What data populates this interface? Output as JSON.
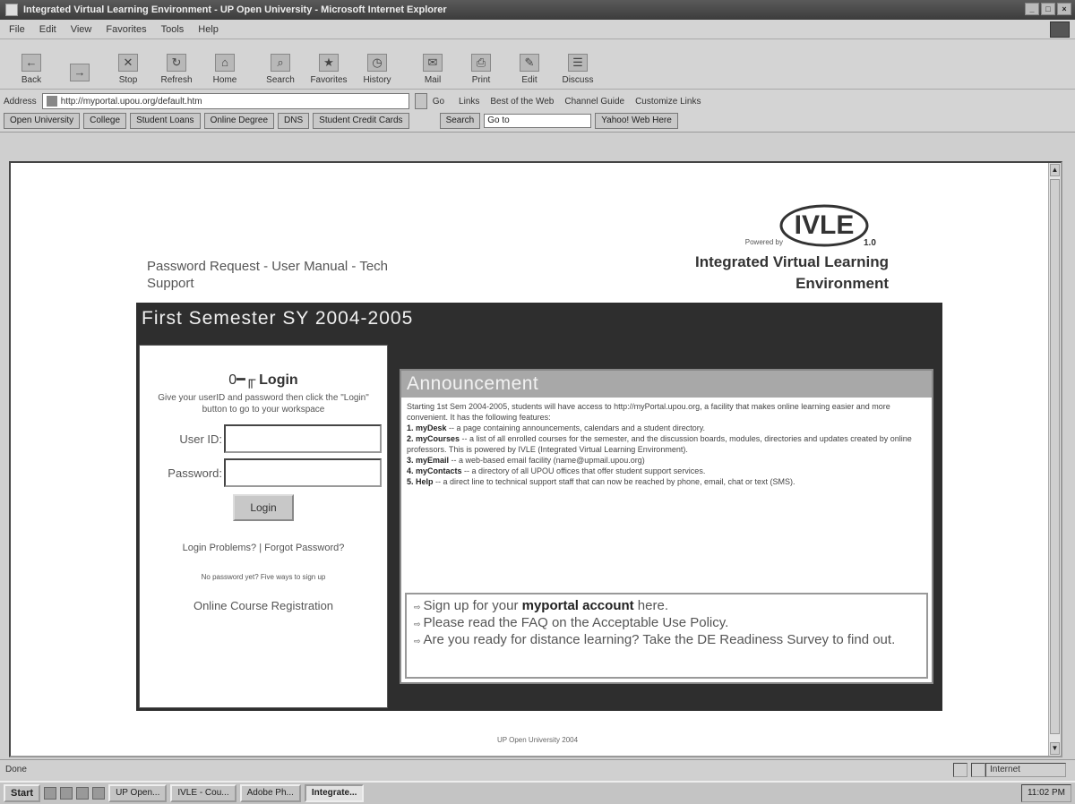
{
  "window": {
    "title": "Integrated Virtual Learning Environment - UP Open University - Microsoft Internet Explorer"
  },
  "menu": [
    "File",
    "Edit",
    "View",
    "Favorites",
    "Tools",
    "Help"
  ],
  "toolbar": [
    {
      "label": "Back",
      "icon": "back-arrow-icon"
    },
    {
      "label": "",
      "icon": "forward-arrow-icon"
    },
    {
      "label": "Stop",
      "icon": "stop-icon"
    },
    {
      "label": "Refresh",
      "icon": "refresh-icon"
    },
    {
      "label": "Home",
      "icon": "home-icon"
    },
    {
      "label": "Search",
      "icon": "search-icon"
    },
    {
      "label": "Favorites",
      "icon": "favorites-icon"
    },
    {
      "label": "History",
      "icon": "history-icon"
    },
    {
      "label": "Mail",
      "icon": "mail-icon"
    },
    {
      "label": "Print",
      "icon": "print-icon"
    },
    {
      "label": "Edit",
      "icon": "edit-icon"
    },
    {
      "label": "Discuss",
      "icon": "discuss-icon"
    }
  ],
  "address": {
    "label": "Address",
    "url": "http://myportal.upou.org/default.htm",
    "go": "Go",
    "links_label": "Links",
    "links": [
      "Best of the Web",
      "Channel Guide",
      "Customize Links"
    ]
  },
  "favbar": {
    "buttons": [
      "Open University",
      "College",
      "Student Loans",
      "Online Degree",
      "DNS",
      "Student Credit Cards"
    ],
    "search_label": "Search",
    "search_value": "Go to",
    "yahoo": "Yahoo! Web Here"
  },
  "page": {
    "top_links_1": "Password Request - User Manual - Tech",
    "top_links_2": "Support",
    "logo_text": "IVLE",
    "logo_version": "1.0",
    "powered_by": "Powered by",
    "brand_1": "Integrated Virtual Learning",
    "brand_2": "Environment",
    "semester": "First Semester SY 2004-2005"
  },
  "login": {
    "heading": "Login",
    "description": "Give your userID and password then click the \"Login\" button to go to your workspace",
    "userid_label": "User ID:",
    "password_label": "Password:",
    "button": "Login",
    "problems_link": "Login Problems? | Forgot Password?",
    "no_password": "No password yet? Five ways to sign up",
    "registration": "Online Course Registration"
  },
  "announcement": {
    "title": "Announcement",
    "intro": "Starting 1st Sem 2004-2005, students will have access to http://myPortal.upou.org, a facility that makes online learning easier and more convenient. It has the following features:",
    "items": [
      {
        "key": "1. myDesk",
        "text": " -- a page containing announcements, calendars and a student directory."
      },
      {
        "key": "2. myCourses",
        "text": " -- a list of all enrolled courses for the semester, and the discussion boards, modules, directories and updates created by online professors. This is powered by IVLE (Integrated Virtual Learning Environment)."
      },
      {
        "key": "3. myEmail",
        "text": " -- a web-based email facility (name@upmail.upou.org)"
      },
      {
        "key": "4. myContacts",
        "text": " -- a directory of all UPOU offices that offer student support services."
      },
      {
        "key": "5. Help",
        "text": " -- a direct line to technical support staff that can now be reached by phone, email, chat or text (SMS)."
      }
    ],
    "links": [
      {
        "pre": "Sign up for your ",
        "bold": "myportal account",
        "post": " here."
      },
      {
        "pre": "Please read the FAQ on the Acceptable Use Policy.",
        "bold": "",
        "post": ""
      },
      {
        "pre": "Are you ready for distance learning? Take the DE Readiness Survey to find out.",
        "bold": "",
        "post": ""
      }
    ]
  },
  "footer": "UP Open University 2004",
  "statusbar": {
    "status": "Done",
    "zone": "Internet"
  },
  "taskbar": {
    "start": "Start",
    "tasks": [
      "UP Open...",
      "IVLE - Cou...",
      "Adobe Ph...",
      "Integrate..."
    ],
    "tray": "11:02 PM"
  }
}
